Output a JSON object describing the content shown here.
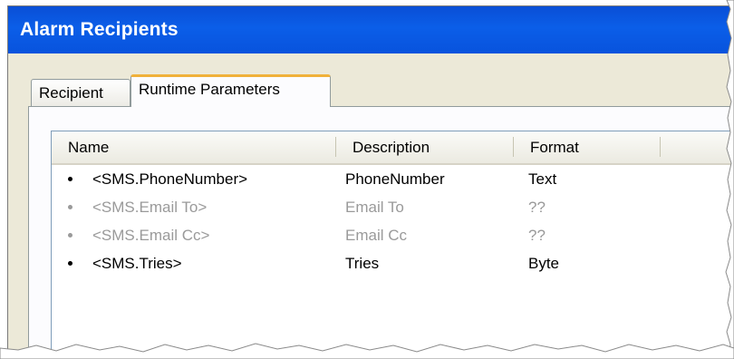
{
  "window": {
    "title": "Alarm Recipients"
  },
  "tabs": [
    {
      "label": "Recipient",
      "active": false
    },
    {
      "label": "Runtime Parameters",
      "active": true
    }
  ],
  "list": {
    "columns": [
      "Name",
      "Description",
      "Format"
    ],
    "rows": [
      {
        "name": "<SMS.PhoneNumber>",
        "description": "PhoneNumber",
        "format": "Text",
        "enabled": true
      },
      {
        "name": "<SMS.Email To>",
        "description": "Email To",
        "format": "??",
        "enabled": false
      },
      {
        "name": "<SMS.Email Cc>",
        "description": "Email Cc",
        "format": "??",
        "enabled": false
      },
      {
        "name": "<SMS.Tries>",
        "description": "Tries",
        "format": "Byte",
        "enabled": true
      }
    ]
  },
  "colors": {
    "title_bar": "#0b5ee8",
    "active_tab_accent": "#f0b13a",
    "enabled_text": "#000000",
    "disabled_text": "#9a9a9a"
  }
}
